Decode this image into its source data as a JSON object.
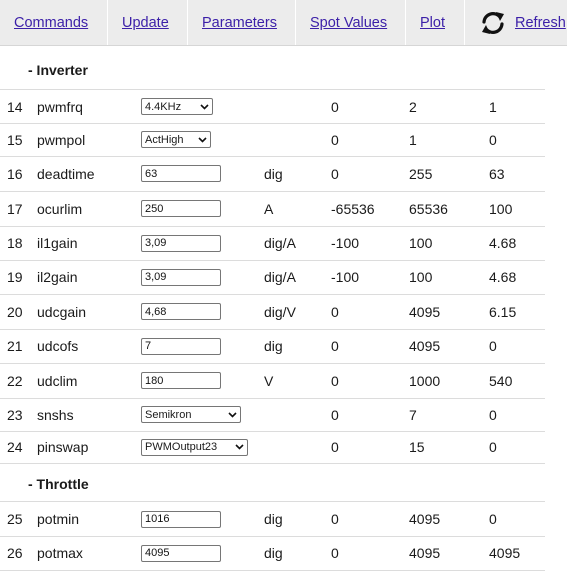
{
  "nav": {
    "commands": "Commands",
    "update": "Update",
    "parameters": "Parameters",
    "spot_values": "Spot Values",
    "plot": "Plot",
    "refresh": "Refresh"
  },
  "sections": {
    "inverter": "- Inverter",
    "throttle": "- Throttle"
  },
  "rows": [
    {
      "idx": "14",
      "name": "pwmfrq",
      "type": "select",
      "value": "4.4KHz",
      "unit": "",
      "min": "0",
      "max": "2",
      "current": "1"
    },
    {
      "idx": "15",
      "name": "pwmpol",
      "type": "select",
      "value": "ActHigh",
      "unit": "",
      "min": "0",
      "max": "1",
      "current": "0"
    },
    {
      "idx": "16",
      "name": "deadtime",
      "type": "input",
      "value": "63",
      "unit": "dig",
      "min": "0",
      "max": "255",
      "current": "63"
    },
    {
      "idx": "17",
      "name": "ocurlim",
      "type": "input",
      "value": "250",
      "unit": "A",
      "min": "-65536",
      "max": "65536",
      "current": "100"
    },
    {
      "idx": "18",
      "name": "il1gain",
      "type": "input",
      "value": "3,09",
      "unit": "dig/A",
      "min": "-100",
      "max": "100",
      "current": "4.68"
    },
    {
      "idx": "19",
      "name": "il2gain",
      "type": "input",
      "value": "3,09",
      "unit": "dig/A",
      "min": "-100",
      "max": "100",
      "current": "4.68"
    },
    {
      "idx": "20",
      "name": "udcgain",
      "type": "input",
      "value": "4,68",
      "unit": "dig/V",
      "min": "0",
      "max": "4095",
      "current": "6.15"
    },
    {
      "idx": "21",
      "name": "udcofs",
      "type": "input",
      "value": "7",
      "unit": "dig",
      "min": "0",
      "max": "4095",
      "current": "0"
    },
    {
      "idx": "22",
      "name": "udclim",
      "type": "input",
      "value": "180",
      "unit": "V",
      "min": "0",
      "max": "1000",
      "current": "540"
    },
    {
      "idx": "23",
      "name": "snshs",
      "type": "select",
      "value": "Semikron",
      "unit": "",
      "min": "0",
      "max": "7",
      "current": "0"
    },
    {
      "idx": "24",
      "name": "pinswap",
      "type": "select",
      "value": "PWMOutput23",
      "unit": "",
      "min": "0",
      "max": "15",
      "current": "0"
    },
    {
      "idx": "25",
      "name": "potmin",
      "type": "input",
      "value": "1016",
      "unit": "dig",
      "min": "0",
      "max": "4095",
      "current": "0"
    },
    {
      "idx": "26",
      "name": "potmax",
      "type": "input",
      "value": "4095",
      "unit": "dig",
      "min": "0",
      "max": "4095",
      "current": "4095"
    }
  ],
  "colors": {
    "nav_bg": "#ececec",
    "link": "#3b1fa8",
    "row_border": "#dcdcdc"
  },
  "icons": {
    "refresh": "refresh-icon",
    "dropdown": "chevron-down-icon"
  }
}
